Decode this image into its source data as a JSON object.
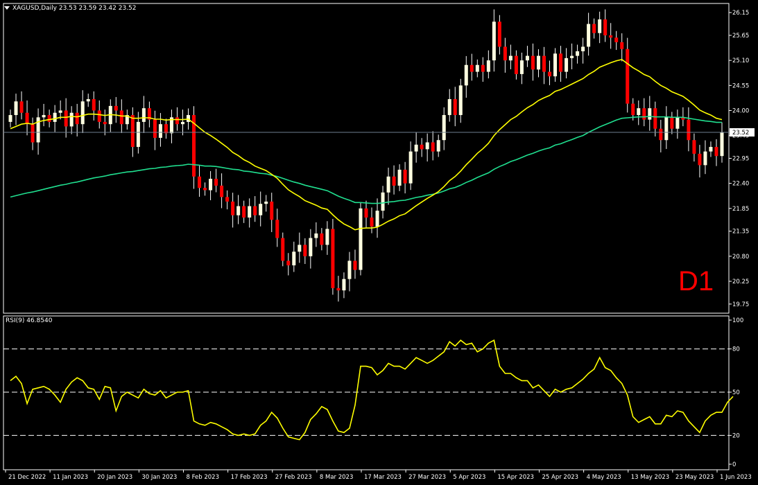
{
  "header": {
    "symbol_line": "XAGUSD,Daily  23.53 23.59 23.42 23.52",
    "rsi_line": "RSI(9) 46.8540",
    "timeframe_badge": "D1"
  },
  "colors": {
    "background": "#000000",
    "frame": "#ffffff",
    "bull_candle": "#ffffe0",
    "bear_candle": "#ff0000",
    "wick": "#ffffff",
    "ma_fast": "#ffff00",
    "ma_slow": "#20e090",
    "rsi_line": "#ffff00",
    "rsi_levels": "#ffffff",
    "price_line": "#708090",
    "badge": "#ff0000"
  },
  "chart_data": [
    {
      "type": "candlestick",
      "symbol": "XAGUSD",
      "timeframe": "Daily",
      "title": "XAGUSD,Daily",
      "last_ohlc": {
        "open": 23.53,
        "high": 23.59,
        "low": 23.42,
        "close": 23.52
      },
      "current_price_label": "23.52",
      "ylim": [
        19.55,
        26.35
      ],
      "y_ticks": [
        "26.15",
        "25.65",
        "25.10",
        "24.55",
        "24.00",
        "23.45",
        "22.95",
        "22.40",
        "21.85",
        "21.35",
        "20.80",
        "20.25",
        "19.75"
      ],
      "x_ticks": [
        "21 Dec 2022",
        "11 Jan 2023",
        "20 Jan 2023",
        "30 Jan 2023",
        "8 Feb 2023",
        "17 Feb 2023",
        "27 Feb 2023",
        "8 Mar 2023",
        "17 Mar 2023",
        "27 Mar 2023",
        "5 Apr 2023",
        "15 Apr 2023",
        "25 Apr 2023",
        "4 May 2023",
        "13 May 2023",
        "23 May 2023",
        "1 Jun 2023"
      ],
      "closes": [
        23.9,
        24.2,
        23.95,
        23.7,
        23.3,
        23.85,
        23.9,
        23.75,
        23.95,
        24.0,
        23.65,
        23.95,
        23.7,
        24.2,
        24.25,
        24.0,
        23.75,
        23.7,
        24.1,
        24.0,
        23.7,
        23.9,
        23.2,
        23.75,
        24.05,
        23.8,
        23.4,
        23.7,
        23.5,
        23.85,
        23.7,
        23.75,
        23.9,
        22.55,
        22.3,
        22.25,
        22.5,
        22.35,
        22.1,
        22.0,
        21.7,
        21.9,
        21.65,
        21.9,
        21.7,
        21.95,
        22.0,
        21.6,
        21.2,
        20.7,
        20.6,
        20.9,
        21.05,
        20.8,
        21.2,
        21.3,
        21.05,
        21.4,
        20.1,
        20.05,
        20.3,
        20.7,
        20.5,
        21.85,
        21.65,
        21.45,
        21.8,
        22.2,
        22.55,
        22.35,
        22.7,
        22.4,
        23.1,
        23.25,
        23.15,
        23.3,
        23.1,
        23.35,
        23.9,
        24.25,
        23.9,
        24.55,
        25.0,
        24.85,
        25.0,
        24.85,
        25.1,
        25.95,
        25.4,
        25.1,
        25.2,
        24.8,
        25.1,
        25.2,
        24.9,
        25.2,
        24.85,
        24.75,
        25.25,
        24.85,
        25.15,
        25.2,
        25.3,
        25.4,
        25.9,
        25.7,
        26.0,
        25.65,
        25.6,
        25.5,
        25.35,
        24.15,
        23.9,
        24.05,
        23.8,
        24.05,
        23.6,
        23.35,
        23.85,
        23.6,
        23.85,
        23.8,
        23.35,
        23.05,
        22.8,
        23.1,
        23.2,
        23.0,
        23.52
      ],
      "series": [
        {
          "name": "MA fast",
          "values": [
            23.6,
            23.65,
            23.7,
            23.72,
            23.7,
            23.75,
            23.78,
            23.8,
            23.82,
            23.85,
            23.85,
            23.87,
            23.86,
            23.89,
            23.92,
            23.92,
            23.91,
            23.89,
            23.91,
            23.9,
            23.88,
            23.88,
            23.83,
            23.83,
            23.84,
            23.84,
            23.81,
            23.81,
            23.79,
            23.8,
            23.8,
            23.8,
            23.81,
            23.72,
            23.62,
            23.52,
            23.45,
            23.37,
            23.28,
            23.19,
            23.08,
            23.01,
            22.92,
            22.86,
            22.78,
            22.73,
            22.68,
            22.6,
            22.51,
            22.38,
            22.26,
            22.18,
            22.11,
            22.02,
            21.97,
            21.92,
            21.86,
            21.83,
            21.71,
            21.6,
            21.51,
            21.45,
            21.38,
            21.41,
            21.42,
            21.42,
            21.44,
            21.5,
            21.57,
            21.62,
            21.69,
            21.73,
            21.82,
            21.91,
            21.99,
            22.07,
            22.14,
            22.22,
            22.33,
            22.46,
            22.55,
            22.67,
            22.81,
            22.93,
            23.06,
            23.16,
            23.28,
            23.45,
            23.58,
            23.69,
            23.8,
            23.87,
            23.97,
            24.06,
            24.13,
            24.22,
            24.28,
            24.33,
            24.42,
            24.46,
            24.52,
            24.58,
            24.64,
            24.7,
            24.79,
            24.86,
            24.95,
            25.0,
            25.05,
            25.09,
            25.12,
            25.03,
            24.94,
            24.87,
            24.79,
            24.74,
            24.64,
            24.55,
            24.49,
            24.41,
            24.36,
            24.31,
            24.22,
            24.12,
            24.01,
            23.95,
            23.9,
            23.83,
            23.8
          ]
        },
        {
          "name": "MA slow",
          "values": [
            22.1,
            22.13,
            22.16,
            22.19,
            22.21,
            22.24,
            22.27,
            22.3,
            22.33,
            22.36,
            22.38,
            22.41,
            22.43,
            22.46,
            22.49,
            22.52,
            22.54,
            22.56,
            22.59,
            22.61,
            22.63,
            22.65,
            22.66,
            22.68,
            22.7,
            22.72,
            22.73,
            22.75,
            22.76,
            22.78,
            22.79,
            22.8,
            22.82,
            22.81,
            22.8,
            22.78,
            22.78,
            22.77,
            22.75,
            22.73,
            22.71,
            22.7,
            22.67,
            22.66,
            22.64,
            22.62,
            22.61,
            22.58,
            22.55,
            22.51,
            22.47,
            22.43,
            22.4,
            22.36,
            22.33,
            22.3,
            22.27,
            22.24,
            22.18,
            22.12,
            22.07,
            22.03,
            21.98,
            21.98,
            21.97,
            21.96,
            21.96,
            21.97,
            21.99,
            22.0,
            22.02,
            22.03,
            22.06,
            22.09,
            22.11,
            22.14,
            22.16,
            22.19,
            22.23,
            22.28,
            22.31,
            22.36,
            22.42,
            22.47,
            22.53,
            22.58,
            22.63,
            22.71,
            22.77,
            22.82,
            22.88,
            22.92,
            22.97,
            23.02,
            23.06,
            23.11,
            23.15,
            23.18,
            23.24,
            23.27,
            23.32,
            23.36,
            23.41,
            23.45,
            23.52,
            23.58,
            23.64,
            23.69,
            23.74,
            23.79,
            23.83,
            23.84,
            23.85,
            23.86,
            23.86,
            23.87,
            23.86,
            23.86,
            23.86,
            23.85,
            23.85,
            23.85,
            23.83,
            23.81,
            23.79,
            23.77,
            23.76,
            23.74,
            23.74
          ]
        }
      ]
    },
    {
      "type": "line",
      "title": "RSI(9) 46.8540",
      "ylim": [
        0,
        100
      ],
      "y_ticks": [
        "100",
        "80",
        "50",
        "20",
        "0"
      ],
      "levels": [
        80,
        50,
        20
      ],
      "x_ticks": [
        "21 Dec 2022",
        "11 Jan 2023",
        "20 Jan 2023",
        "30 Jan 2023",
        "8 Feb 2023",
        "17 Feb 2023",
        "27 Feb 2023",
        "8 Mar 2023",
        "17 Mar 2023",
        "27 Mar 2023",
        "5 Apr 2023",
        "15 Apr 2023",
        "25 Apr 2023",
        "4 May 2023",
        "13 May 2023",
        "23 May 2023",
        "1 Jun 2023"
      ],
      "series": [
        {
          "name": "RSI(9)",
          "values": [
            58,
            61,
            56,
            42,
            52,
            53,
            54,
            52,
            48,
            43,
            52,
            57,
            60,
            58,
            53,
            52,
            45,
            54,
            53,
            37,
            47,
            50,
            48,
            46,
            52,
            49,
            48,
            51,
            46,
            48,
            50,
            50,
            51,
            30,
            28,
            27,
            29,
            28,
            26,
            24,
            21,
            20,
            21,
            20,
            21,
            27,
            30,
            36,
            32,
            25,
            19,
            18,
            17,
            22,
            31,
            35,
            40,
            38,
            30,
            23,
            22,
            25,
            41,
            68,
            68,
            67,
            62,
            65,
            70,
            68,
            68,
            66,
            70,
            74,
            72,
            70,
            72,
            75,
            78,
            85,
            82,
            86,
            83,
            84,
            78,
            80,
            84,
            86,
            68,
            63,
            63,
            60,
            58,
            58,
            53,
            55,
            51,
            47,
            52,
            50,
            52,
            53,
            56,
            59,
            63,
            66,
            74,
            67,
            65,
            60,
            56,
            48,
            33,
            29,
            31,
            33,
            28,
            28,
            34,
            33,
            37,
            36,
            30,
            26,
            22,
            30,
            34,
            36,
            36,
            43,
            47
          ]
        }
      ]
    }
  ]
}
